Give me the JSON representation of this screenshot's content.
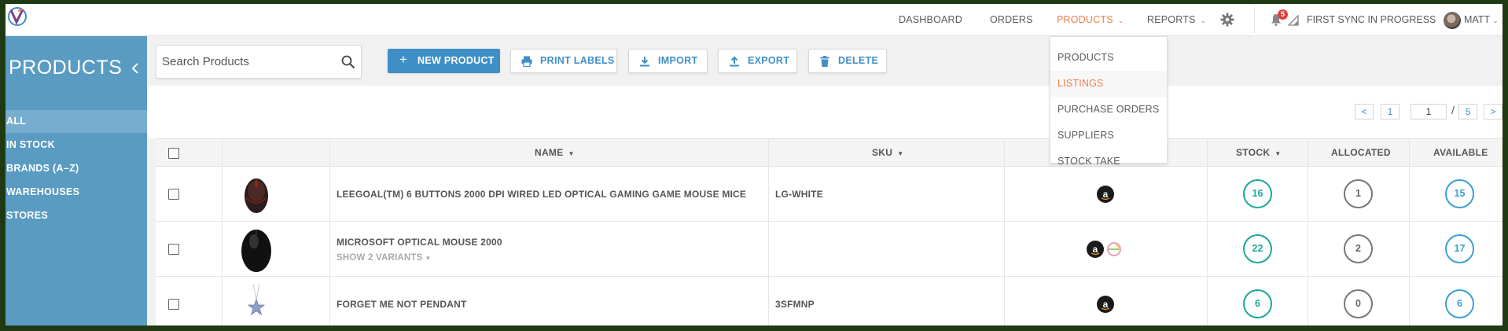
{
  "topnav": {
    "items": [
      {
        "label": "DASHBOARD",
        "has_chevron": false,
        "active": false
      },
      {
        "label": "ORDERS",
        "has_chevron": false,
        "active": false
      },
      {
        "label": "PRODUCTS",
        "has_chevron": true,
        "active": true
      },
      {
        "label": "REPORTS",
        "has_chevron": true,
        "active": false
      }
    ],
    "notification_count": "5",
    "sync_status": "FIRST SYNC IN PROGRESS",
    "user_name": "MATT"
  },
  "products_menu": {
    "items": [
      "PRODUCTS",
      "LISTINGS",
      "PURCHASE ORDERS",
      "SUPPLIERS",
      "STOCK TAKE"
    ],
    "highlighted": "LISTINGS"
  },
  "sidebar": {
    "title": "PRODUCTS",
    "items": [
      "ALL",
      "IN STOCK",
      "BRANDS (A–Z)",
      "WAREHOUSES",
      "STORES"
    ],
    "active_item": "ALL"
  },
  "toolbar": {
    "search_placeholder": "Search Products",
    "new_product": "NEW PRODUCT",
    "print_labels": "PRINT LABELS",
    "import": "IMPORT",
    "export": "EXPORT",
    "delete": "DELETE"
  },
  "pagination": {
    "prev": "<",
    "first": "1",
    "current": "1",
    "separator": "/",
    "total": "5",
    "next": ">"
  },
  "table": {
    "headers": {
      "name": "NAME",
      "sku": "SKU",
      "stock": "STOCK",
      "allocated": "ALLOCATED",
      "available": "AVAILABLE"
    },
    "rows": [
      {
        "name": "LEEGOAL(TM) 6 BUTTONS 2000 DPI WIRED LED OPTICAL GAMING GAME MOUSE MICE",
        "sku": "LG-WHITE",
        "variants": "",
        "channels": [
          "amazon-icon"
        ],
        "thumb": "gaming-mouse-image",
        "stock": "16",
        "allocated": "1",
        "available": "15"
      },
      {
        "name": "MICROSOFT OPTICAL MOUSE 2000",
        "sku": "",
        "variants": "SHOW 2 VARIANTS",
        "channels": [
          "amazon-icon",
          "ebay-icon"
        ],
        "thumb": "microsoft-mouse-image",
        "stock": "22",
        "allocated": "2",
        "available": "17"
      },
      {
        "name": "FORGET ME NOT PENDANT",
        "sku": "3SFMNP",
        "variants": "",
        "channels": [
          "amazon-icon"
        ],
        "thumb": "pendant-image",
        "stock": "6",
        "allocated": "0",
        "available": "6"
      }
    ]
  },
  "colors": {
    "accent_orange": "#ef7d4d",
    "sidebar_blue": "#5a9bc2",
    "primary_blue": "#3f8fc7",
    "stock_green": "#1aa89a",
    "allocated_gray": "#777777",
    "available_blue": "#3a9fd6"
  }
}
